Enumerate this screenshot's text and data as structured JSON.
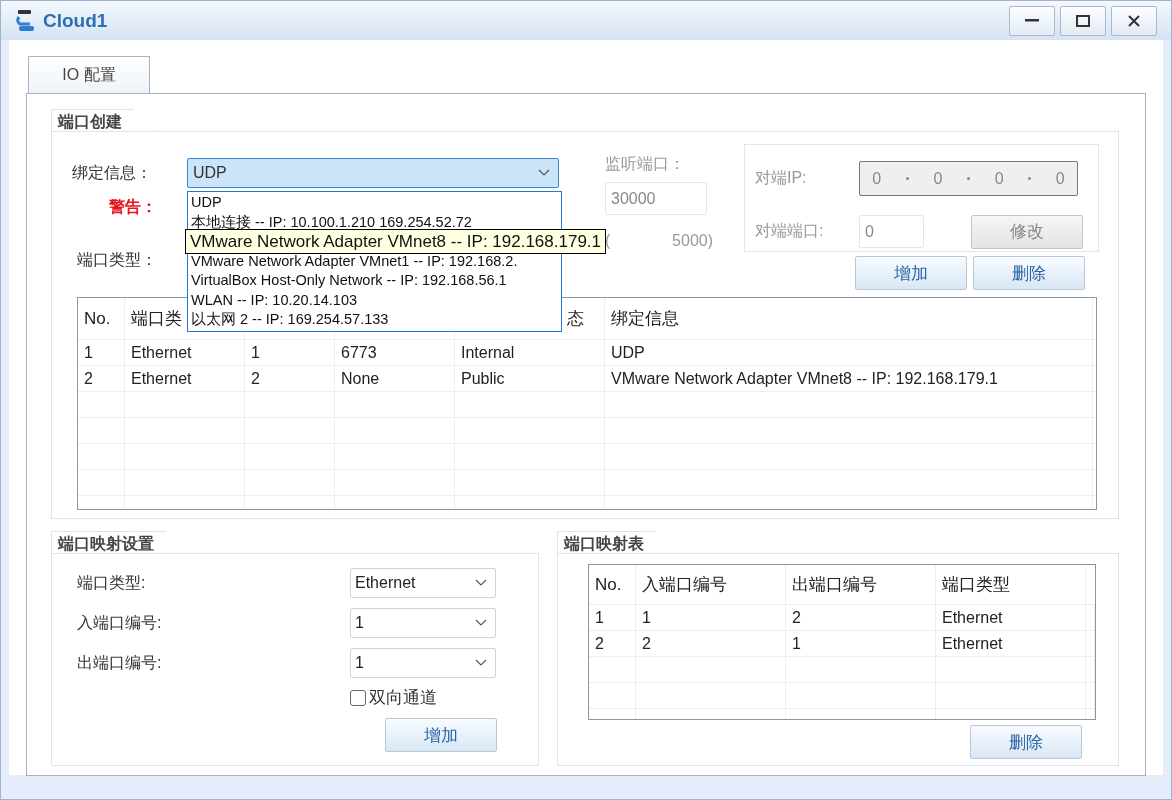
{
  "window": {
    "title": "Cloud1"
  },
  "tabs": [
    {
      "label": "IO 配置",
      "selected": true
    }
  ],
  "port_creation": {
    "title": "端口创建",
    "binding_label": "绑定信息：",
    "binding_value": "UDP",
    "warning_label": "警告：",
    "port_type_label": "端口类型：",
    "listen_port_label": "监听端口：",
    "listen_port_value": "30000",
    "hint_parts": [
      "(",
      "5000)"
    ],
    "peer": {
      "ip_label": "对端IP:",
      "ip_octets": [
        "0",
        "0",
        "0",
        "0"
      ],
      "port_label": "对端端口:",
      "port_value": "0",
      "modify_button": {
        "label": "修改",
        "disabled": true
      }
    },
    "buttons": [
      "增加",
      "删除"
    ],
    "dropdown": {
      "expanded": true,
      "items": [
        {
          "label": "UDP"
        },
        {
          "label": "本地连接 -- IP: 10.100.1.210 169.254.52.72"
        },
        {
          "tooltip": "VMware Network Adapter VMnet8 -- IP: 192.168.179.1"
        },
        {
          "label": "VMware Network Adapter VMnet1 -- IP: 192.168.2."
        },
        {
          "label": "VirtualBox Host-Only Network -- IP: 192.168.56.1"
        },
        {
          "label": "WLAN -- IP: 10.20.14.103"
        },
        {
          "label": "以太网 2 -- IP: 169.254.57.133"
        }
      ]
    },
    "table": {
      "columns": [
        {
          "label": "No."
        },
        {
          "label": "端口类"
        },
        {},
        {},
        {
          "label": "态",
          "clipped_start": true
        },
        {
          "label": "绑定信息"
        }
      ],
      "rows": [
        [
          "1",
          "Ethernet",
          "1",
          "6773",
          "Internal",
          "UDP"
        ],
        [
          "2",
          "Ethernet",
          "2",
          "None",
          "Public",
          "VMware Network Adapter VMnet8 -- IP: 192.168.179.1"
        ]
      ]
    }
  },
  "port_mapping": {
    "title": "端口映射设置",
    "fields": [
      {
        "label": "端口类型:",
        "value": "Ethernet"
      },
      {
        "label": "入端口编号:",
        "value": "1"
      },
      {
        "label": "出端口编号:",
        "value": "1"
      }
    ],
    "bidirectional": {
      "label": "双向通道",
      "checked": false
    },
    "add_button": "增加"
  },
  "mapping_table": {
    "title": "端口映射表",
    "columns": [
      "No.",
      "入端口编号",
      "出端口编号",
      "端口类型"
    ],
    "rows": [
      [
        "1",
        "1",
        "2",
        "Ethernet"
      ],
      [
        "2",
        "2",
        "1",
        "Ethernet"
      ]
    ],
    "delete_button": "删除"
  }
}
